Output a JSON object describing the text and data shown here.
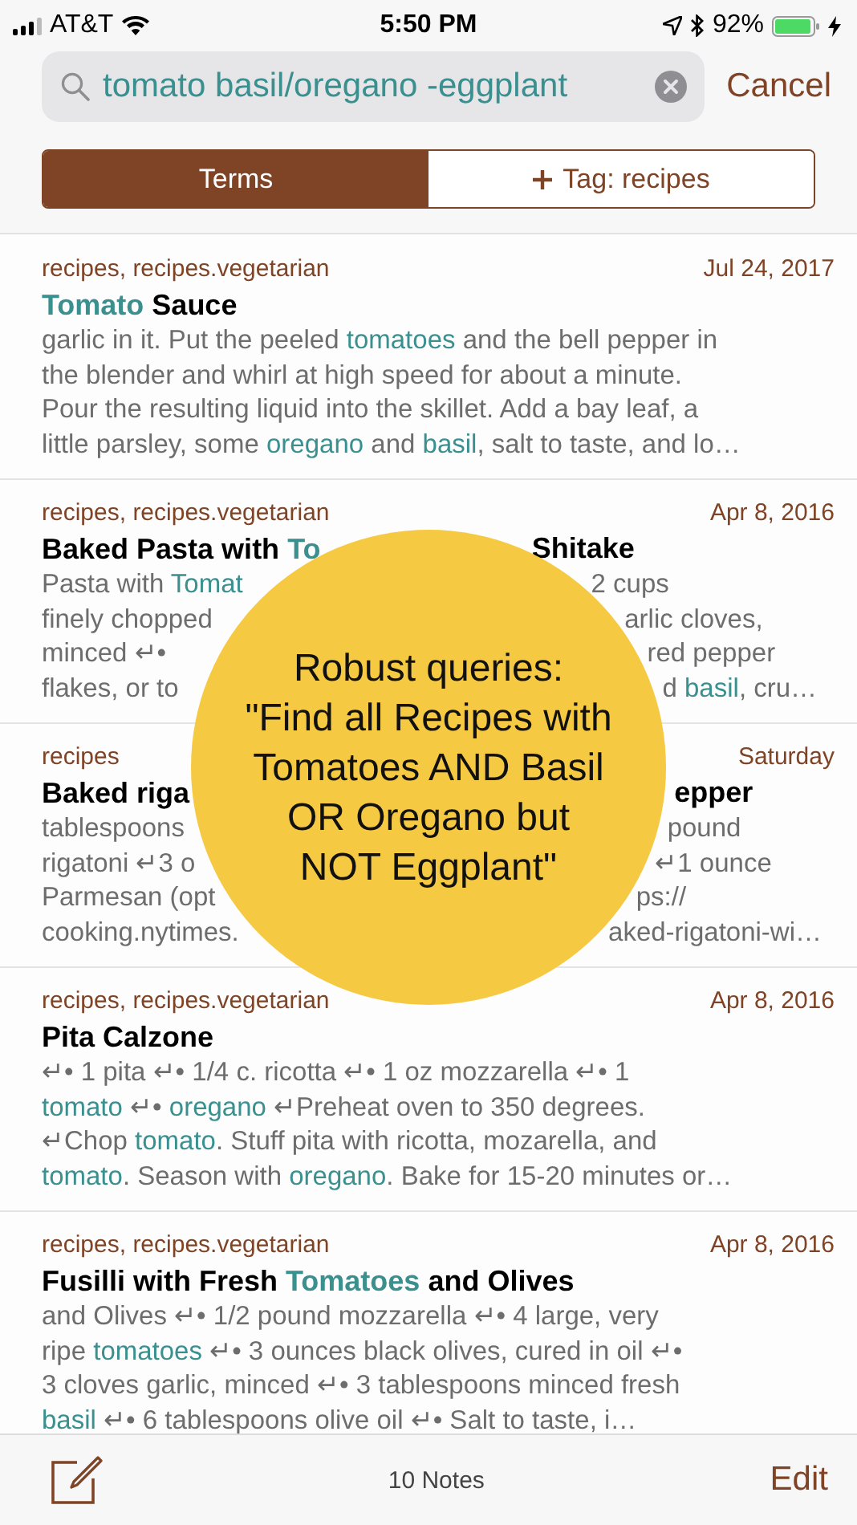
{
  "status_bar": {
    "carrier": "AT&T",
    "time": "5:50 PM",
    "battery": "92%"
  },
  "search": {
    "value": "tomato basil/oregano -eggplant",
    "cancel": "Cancel"
  },
  "segments": [
    {
      "label": "Terms",
      "kind": "text",
      "selected": true
    },
    {
      "label": "Tag: recipes",
      "kind": "add",
      "selected": false
    }
  ],
  "notes": [
    {
      "tags": "recipes, recipes.vegetarian",
      "date": "Jul 24, 2017",
      "title": {
        "left": [
          {
            "text": "Tomato",
            "match": true
          },
          {
            "text": " Sauce",
            "match": false
          }
        ]
      },
      "lines": [
        {
          "left": [
            {
              "text": "garlic in it. Put the peeled ",
              "match": false
            },
            {
              "text": "tomatoes",
              "match": true
            },
            {
              "text": " and the bell pepper in",
              "match": false
            }
          ]
        },
        {
          "left": [
            {
              "text": "the blender and whirl at high speed for about a minute.",
              "match": false
            }
          ]
        },
        {
          "left": [
            {
              "text": "Pour the resulting liquid into the skillet. Add a bay leaf, a",
              "match": false
            }
          ]
        },
        {
          "left": [
            {
              "text": "little parsley, some ",
              "match": false
            },
            {
              "text": "oregano",
              "match": true
            },
            {
              "text": " and ",
              "match": false
            },
            {
              "text": "basil",
              "match": true
            },
            {
              "text": ", salt to taste, and lo…",
              "match": false
            }
          ]
        }
      ]
    },
    {
      "tags": "recipes, recipes.vegetarian",
      "date": "Apr 8, 2016",
      "title": {
        "left": [
          {
            "text": "Baked Pasta with ",
            "match": false
          },
          {
            "text": "To",
            "match": true
          }
        ],
        "right": [
          {
            "text": "Shitake",
            "match": false
          }
        ]
      },
      "lines": [
        {
          "left": [
            {
              "text": "Pasta with ",
              "match": false
            },
            {
              "text": "Tomat",
              "match": true
            }
          ],
          "right": [
            {
              "text": "2 cups",
              "match": false
            }
          ]
        },
        {
          "left": [
            {
              "text": "finely chopped",
              "match": false
            }
          ],
          "right": [
            {
              "text": "arlic cloves,",
              "match": false
            }
          ]
        },
        {
          "left": [
            {
              "text": "minced  ↵•",
              "match": false
            }
          ],
          "right": [
            {
              "text": "red pepper",
              "match": false
            }
          ]
        },
        {
          "left": [
            {
              "text": "flakes, or to",
              "match": false
            }
          ],
          "right": [
            {
              "text": "d ",
              "match": false
            },
            {
              "text": "basil",
              "match": true
            },
            {
              "text": ", cru…",
              "match": false
            }
          ]
        }
      ]
    },
    {
      "tags": "recipes",
      "date": "Saturday",
      "title": {
        "left": [
          {
            "text": "Baked riga",
            "match": false
          }
        ],
        "right": [
          {
            "text": "epper",
            "match": false
          }
        ]
      },
      "lines": [
        {
          "left": [
            {
              "text": "tablespoons",
              "match": false
            }
          ],
          "right": [
            {
              "text": "pound",
              "match": false
            }
          ]
        },
        {
          "left": [
            {
              "text": "rigatoni ↵3 o",
              "match": false
            }
          ],
          "right": [
            {
              "text": "↵1 ounce",
              "match": false
            }
          ]
        },
        {
          "left": [
            {
              "text": "Parmesan (opt",
              "match": false
            }
          ],
          "right": [
            {
              "text": "ps://",
              "match": false
            }
          ]
        },
        {
          "left": [
            {
              "text": "cooking.nytimes.",
              "match": false
            }
          ],
          "right": [
            {
              "text": "aked-rigatoni-wi…",
              "match": false
            }
          ]
        }
      ]
    },
    {
      "tags": "recipes, recipes.vegetarian",
      "date": "Apr 8, 2016",
      "title": {
        "left": [
          {
            "text": "Pita Calzone",
            "match": false
          }
        ]
      },
      "lines": [
        {
          "left": [
            {
              "text": "↵•   1 pita ↵•       1/4 c. ricotta ↵•   1 oz mozzarella ↵•  1",
              "match": false
            }
          ]
        },
        {
          "left": [
            {
              "text": "tomato",
              "match": true
            },
            {
              "text": " ↵•     ",
              "match": false
            },
            {
              "text": "oregano",
              "match": true
            },
            {
              "text": " ↵Preheat oven to 350 degrees.",
              "match": false
            }
          ]
        },
        {
          "left": [
            {
              "text": "↵Chop ",
              "match": false
            },
            {
              "text": "tomato",
              "match": true
            },
            {
              "text": ". Stuff pita with ricotta, mozarella, and",
              "match": false
            }
          ]
        },
        {
          "left": [
            {
              "text": "tomato",
              "match": true
            },
            {
              "text": ". Season with ",
              "match": false
            },
            {
              "text": "oregano",
              "match": true
            },
            {
              "text": ". Bake for 15-20 minutes or…",
              "match": false
            }
          ]
        }
      ]
    },
    {
      "tags": "recipes, recipes.vegetarian",
      "date": "Apr 8, 2016",
      "title": {
        "left": [
          {
            "text": "Fusilli with Fresh ",
            "match": false
          },
          {
            "text": "Tomatoes",
            "match": true
          },
          {
            "text": " and Olives",
            "match": false
          }
        ]
      },
      "lines": [
        {
          "left": [
            {
              "text": "and Olives ↵•      1/2 pound mozzarella ↵•   4 large, very",
              "match": false
            }
          ]
        },
        {
          "left": [
            {
              "text": "ripe ",
              "match": false
            },
            {
              "text": "tomatoes",
              "match": true
            },
            {
              "text": " ↵•       3 ounces black olives, cured in oil  ↵•",
              "match": false
            }
          ]
        },
        {
          "left": [
            {
              "text": "3 cloves garlic, minced  ↵•       3 tablespoons minced fresh",
              "match": false
            }
          ]
        },
        {
          "left": [
            {
              "text": "basil",
              "match": true
            },
            {
              "text": "  ↵•       6 tablespoons olive oil  ↵•       Salt to taste, i…",
              "match": false
            }
          ]
        }
      ]
    }
  ],
  "callout": [
    "Robust queries:",
    "\"Find all Recipes with",
    "Tomatoes AND Basil",
    "OR Oregano but",
    "NOT Eggplant\""
  ],
  "toolbar": {
    "count": "10 Notes",
    "edit": "Edit"
  }
}
